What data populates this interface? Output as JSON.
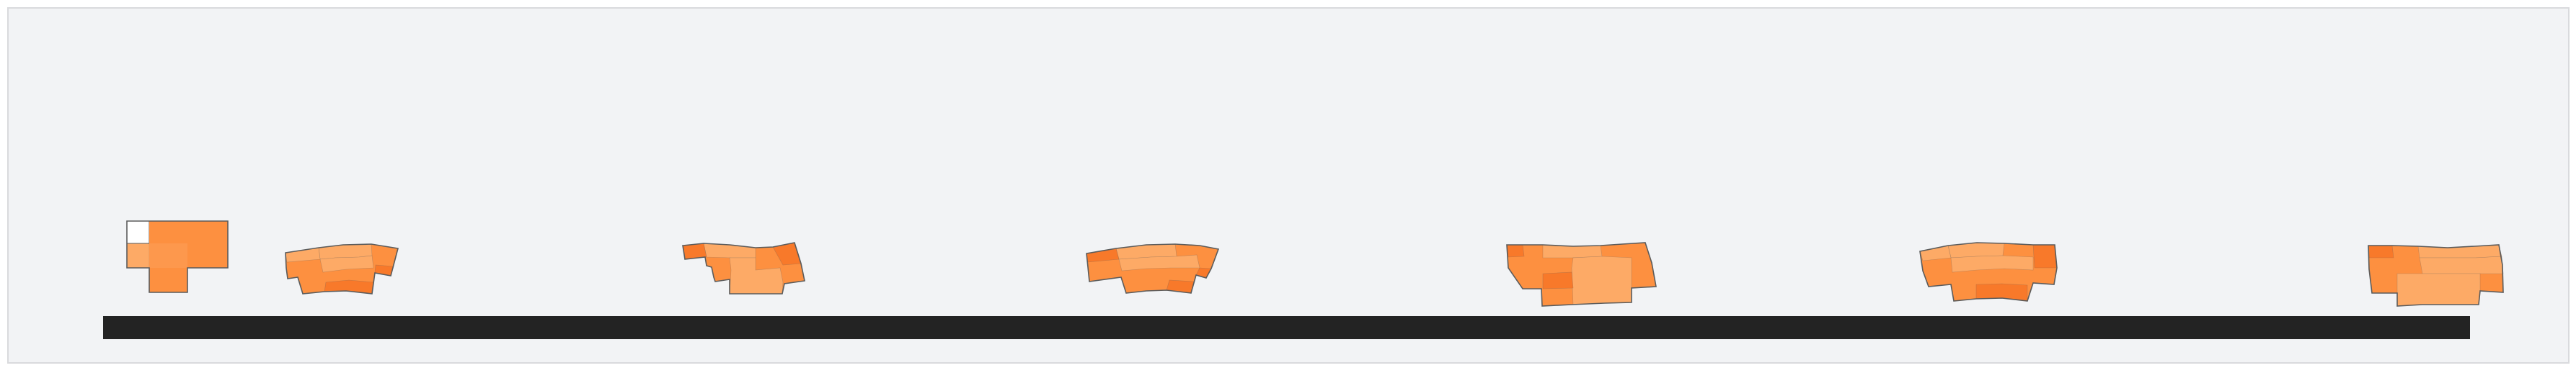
{
  "scene": {
    "panel_bg": "#f2f3f5",
    "panel_border": "#d9dadd",
    "ground_color": "#232323",
    "outline_color": "#5b5b5b",
    "palette": {
      "orange": "#fd9040",
      "light_orange": "#fdaa66",
      "deep_orange": "#f8792a",
      "white": "#ffffff"
    }
  },
  "pieces": [
    {
      "id": "reference-piece",
      "kind": "reference"
    },
    {
      "id": "deformed-piece-1",
      "kind": "deformed"
    },
    {
      "id": "deformed-piece-2",
      "kind": "deformed"
    },
    {
      "id": "deformed-piece-3",
      "kind": "deformed"
    },
    {
      "id": "deformed-piece-4",
      "kind": "deformed"
    },
    {
      "id": "deformed-piece-5",
      "kind": "deformed"
    },
    {
      "id": "deformed-piece-6",
      "kind": "deformed"
    }
  ]
}
